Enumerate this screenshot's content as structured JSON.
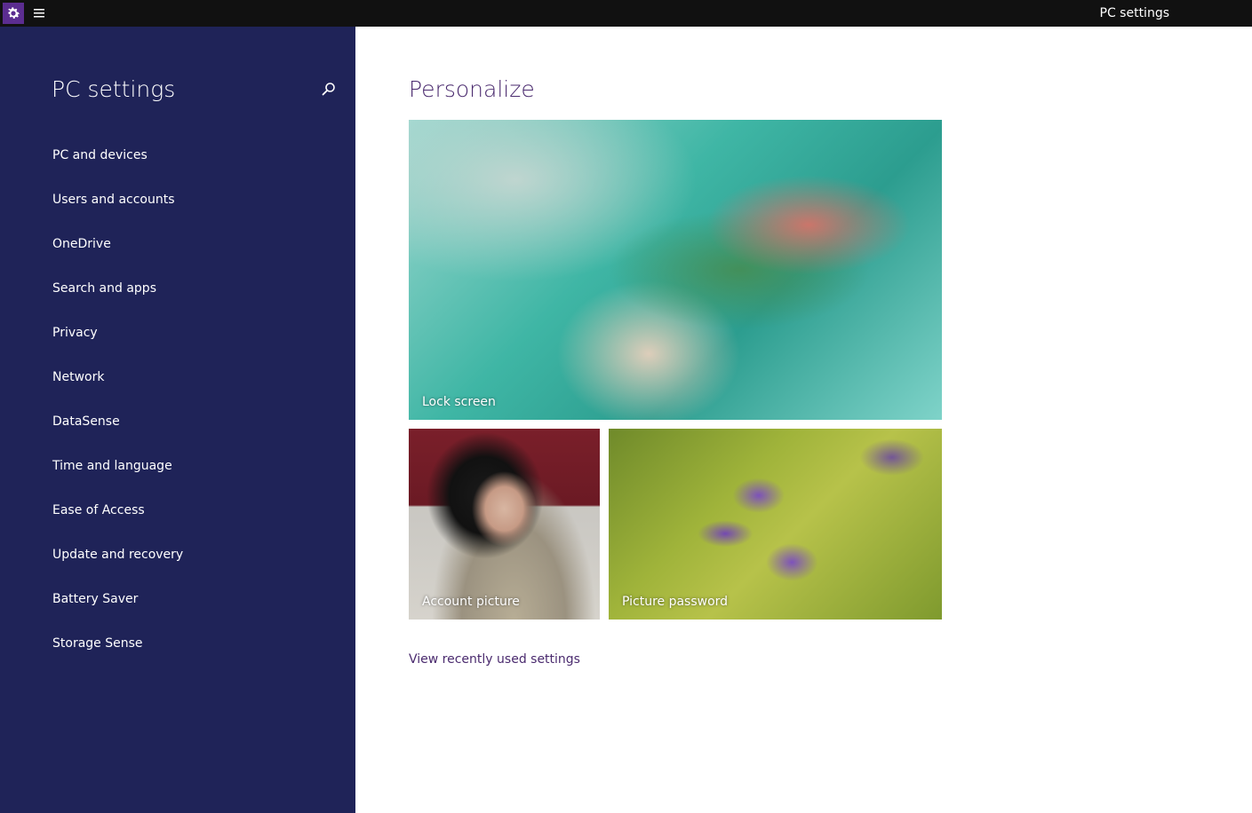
{
  "titlebar": {
    "title": "PC settings",
    "app_icon": "gear-icon",
    "menu_icon": "hamburger-menu-icon",
    "accent_color": "#5b2d90"
  },
  "sidebar": {
    "title": "PC settings",
    "search_icon": "search-icon",
    "background_color": "#1f2358",
    "items": [
      {
        "label": "PC and devices"
      },
      {
        "label": "Users and accounts"
      },
      {
        "label": "OneDrive"
      },
      {
        "label": "Search and apps"
      },
      {
        "label": "Privacy"
      },
      {
        "label": "Network"
      },
      {
        "label": "DataSense"
      },
      {
        "label": "Time and language"
      },
      {
        "label": "Ease of Access"
      },
      {
        "label": "Update and recovery"
      },
      {
        "label": "Battery Saver"
      },
      {
        "label": "Storage Sense"
      }
    ]
  },
  "main": {
    "title": "Personalize",
    "tiles": {
      "lock_screen": "Lock screen",
      "account_picture": "Account picture",
      "picture_password": "Picture password"
    },
    "recent_link": "View recently used settings",
    "accent_text_color": "#4a2a6e"
  }
}
